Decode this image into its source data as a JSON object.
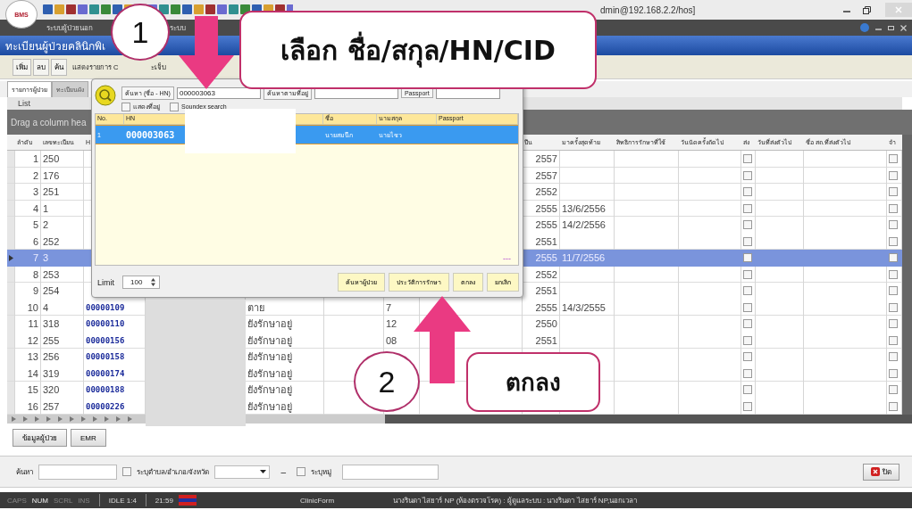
{
  "window": {
    "logo": "BMS",
    "title": "dmin@192.168.2.2/hos]"
  },
  "menu": [
    "ระบบผู้ป่วยนอก",
    "ระบบ"
  ],
  "module_title": "ทะเบียนผู้ป่วยคลินิกพิเ",
  "toolbar": {
    "buttons": [
      "เพิ่ม",
      "ลบ",
      "ค้น"
    ],
    "filter_label": "แสดงรายการ C",
    "filter_tail": "ะเจ็บ"
  },
  "tabs": [
    {
      "label": "รายการผู้ป่วย",
      "selected": true
    },
    {
      "label": "ทะเบียนผัง",
      "selected": false
    }
  ],
  "list_header": "List",
  "group_hint": "Drag a column hea",
  "grid": {
    "columns": {
      "seq": "ลำดับ",
      "reg": "เลขทะเบียน",
      "hn": "H",
      "year": "ปีน",
      "last_visit": "มาครั้งสุดท้าย",
      "right": "สิทธิการรักษาที่ใช้",
      "appointment": "วันนัดครั้งถัดไป",
      "send": "ส่ง",
      "send_date": "วันที่ส่งตัวไป",
      "send_place": "ชื่อ สถ.ที่ส่งตัวไป",
      "column_16": "จำ"
    },
    "rows": [
      {
        "seq": "1",
        "reg": "250",
        "year": "2557",
        "send": false,
        "column_16": false,
        "selected": false
      },
      {
        "seq": "2",
        "reg": "176",
        "year": "2557",
        "send": false,
        "column_16": false,
        "selected": false
      },
      {
        "seq": "3",
        "reg": "251",
        "year": "2552",
        "send": false,
        "column_16": false,
        "selected": false
      },
      {
        "seq": "4",
        "reg": "1",
        "year": "2555",
        "last_visit": "13/6/2556",
        "send": false,
        "column_16": false,
        "selected": false
      },
      {
        "seq": "5",
        "reg": "2",
        "year": "2555",
        "last_visit": "14/2/2556",
        "send": false,
        "column_16": false,
        "selected": false
      },
      {
        "seq": "6",
        "reg": "252",
        "year": "2551",
        "send": false,
        "column_16": false,
        "selected": false
      },
      {
        "seq": "7",
        "reg": "3",
        "year": "2555",
        "last_visit": "11/7/2556",
        "send": false,
        "column_16": false,
        "selected": true
      },
      {
        "seq": "8",
        "reg": "253",
        "year": "2552",
        "send": false,
        "column_16": false,
        "selected": false
      },
      {
        "seq": "9",
        "reg": "254",
        "year": "2551",
        "send": false,
        "column_16": false,
        "selected": false
      },
      {
        "seq": "10",
        "reg": "4",
        "hn": "00000109",
        "status": "ตาย",
        "column_8": "7",
        "year": "2555",
        "last_visit": "14/3/2555",
        "send": false,
        "column_16": false,
        "selected": false
      },
      {
        "seq": "11",
        "reg": "318",
        "hn": "00000110",
        "status": "ยังรักษาอยู่",
        "column_8": "12",
        "year": "2550",
        "send": false,
        "column_16": false,
        "selected": false
      },
      {
        "seq": "12",
        "reg": "255",
        "hn": "00000156",
        "status": "ยังรักษาอยู่",
        "column_8": "08",
        "year": "2551",
        "send": false,
        "column_16": false,
        "selected": false
      },
      {
        "seq": "13",
        "reg": "256",
        "hn": "00000158",
        "status": "ยังรักษาอยู่",
        "send": false,
        "column_16": false,
        "selected": false
      },
      {
        "seq": "14",
        "reg": "319",
        "hn": "00000174",
        "status": "ยังรักษาอยู่",
        "send": false,
        "column_16": false,
        "selected": false
      },
      {
        "seq": "15",
        "reg": "320",
        "hn": "00000188",
        "status": "ยังรักษาอยู่",
        "send": false,
        "column_16": false,
        "selected": false
      },
      {
        "seq": "16",
        "reg": "257",
        "hn": "00000226",
        "status": "ยังรักษาอยู่",
        "send": false,
        "column_16": false,
        "selected": false
      }
    ]
  },
  "dialog": {
    "search_label": "ค้นหา (ชื่อ - HN)",
    "search_value": "000003063",
    "address_label": "ค้นหาตามที่อยู่",
    "passport_label": "Passport",
    "checkboxes": [
      {
        "label": "แสดงที่อยู่",
        "checked": false
      },
      {
        "label": "Soundex search",
        "checked": false
      }
    ],
    "columns": [
      "No.",
      "HN",
      "ชื่อ",
      "นามสกุล",
      "Passport"
    ],
    "rows": [
      {
        "no": "1",
        "hn": "000003063",
        "first_name": "นายสมนึก",
        "last_name": "นายไชว",
        "selected": true
      }
    ],
    "more": "---",
    "limit_label": "Limit",
    "limit_value": "100",
    "buttons": [
      "ค้นหาผู้ป่วย",
      "ประวัติการรักษา",
      "ตกลง",
      "ยกเลิก"
    ]
  },
  "annotations": {
    "step_1": "1",
    "label_1": "เลือก ชื่อ/สกุล/HN/CID",
    "step_2": "2",
    "label_2": "ตกลง"
  },
  "bottom_buttons": [
    "ข้อมูลผู้ป่วย",
    "EMR"
  ],
  "search_panel": {
    "label": "ค้นหา",
    "area_check": {
      "label": "ระบุตำบล/อำเภอ/จังหวัด",
      "checked": false
    },
    "dash": "–",
    "village_check": {
      "label": "ระบุหมู่",
      "checked": false
    },
    "close_button": "ปิด"
  },
  "status_bar": {
    "indicators": [
      {
        "label": "CAPS",
        "on": false
      },
      {
        "label": "NUM",
        "on": true
      },
      {
        "label": "SCRL",
        "on": false
      },
      {
        "label": "INS",
        "on": false
      }
    ],
    "idle": "IDLE 1:4",
    "time": "21:59",
    "form": "ClinicForm",
    "user": "นางรินดา ไสยาร์ NP (ห้องตรวจโรค) : ผู้ดูแลระบบ : นางรินดา ไสยาร์ NP,นอกเวลา"
  }
}
